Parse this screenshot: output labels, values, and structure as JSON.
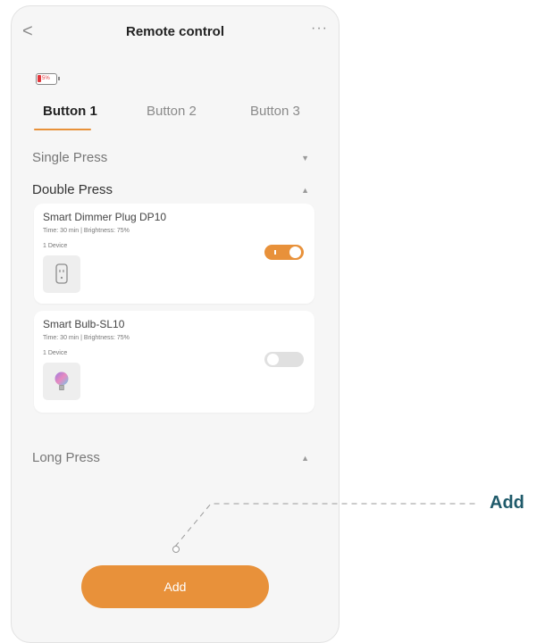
{
  "header": {
    "title": "Remote control",
    "back_glyph": "<",
    "more_glyph": "···"
  },
  "battery": {
    "level_text": "5%",
    "level_percent": 5,
    "color": "#e0353a"
  },
  "tabs": [
    {
      "label": "Button 1",
      "active": true
    },
    {
      "label": "Button 2",
      "active": false
    },
    {
      "label": "Button 3",
      "active": false
    }
  ],
  "sections": {
    "single_press": {
      "label": "Single Press",
      "expanded": false
    },
    "double_press": {
      "label": "Double Press",
      "expanded": true
    },
    "long_press": {
      "label": "Long Press",
      "expanded": true
    }
  },
  "devices": [
    {
      "name": "Smart Dimmer Plug DP10",
      "detail": "Time: 30 min  |  Brightness: 75%",
      "count": "1 Device",
      "icon": "plug-icon",
      "enabled": true
    },
    {
      "name": "Smart Bulb-SL10",
      "detail": "Time: 30 min  |  Brightness: 75%",
      "count": "1 Device",
      "icon": "bulb-icon",
      "enabled": false
    }
  ],
  "add_button": {
    "label": "Add"
  },
  "callout": {
    "label": "Add"
  },
  "colors": {
    "accent": "#e8913a",
    "callout": "#1f5a6a",
    "background": "#f6f6f6"
  }
}
